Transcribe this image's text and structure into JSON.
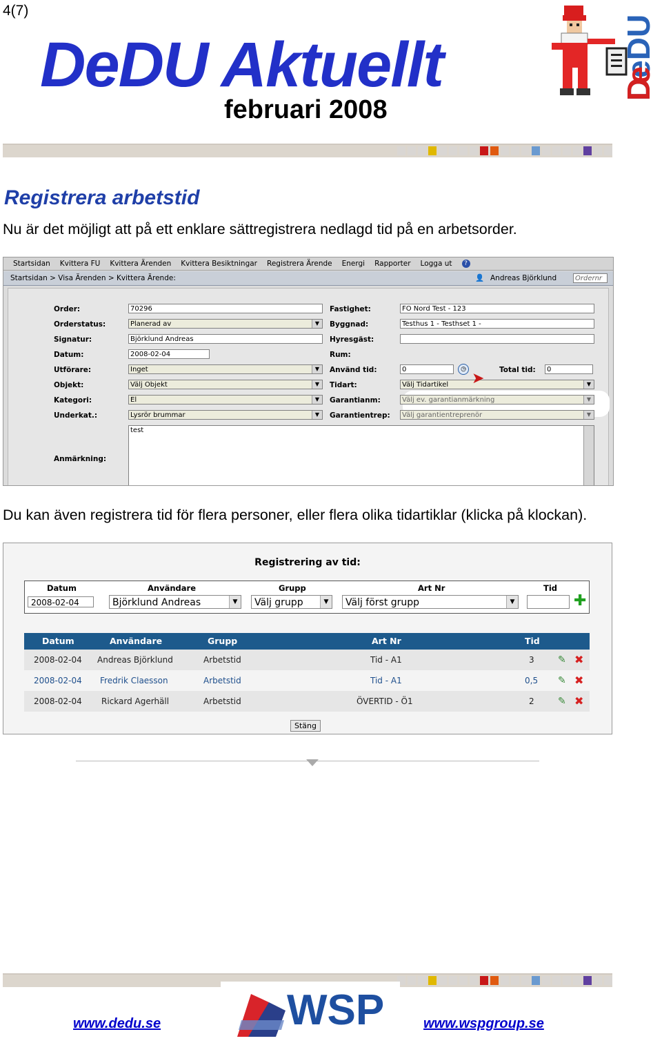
{
  "header": {
    "page_number": "4(7)",
    "masthead_part1": "DeDU",
    "masthead_part2": "Aktuellt",
    "issue": "februari 2008",
    "logo_text": "DeDU"
  },
  "section": {
    "heading": "Registrera arbetstid",
    "intro": "Nu är det möjligt att på ett enklare sättregistrera nedlagd tid på en arbetsorder.",
    "para2": "Du kan även registrera tid för flera personer, eller flera olika tidartiklar (klicka på klockan)."
  },
  "shot1": {
    "menu": [
      "Startsidan",
      "Kvittera FU",
      "Kvittera Ärenden",
      "Kvittera Besiktningar",
      "Registrera Ärende",
      "Energi",
      "Rapporter",
      "Logga ut"
    ],
    "breadcrumb": "Startsidan > Visa Ärenden > Kvittera Ärende:",
    "user": "Andreas Björklund",
    "ordernr_placeholder": "Ordernr",
    "left": {
      "order_label": "Order:",
      "order_value": "70296",
      "status_label": "Orderstatus:",
      "status_value": "Planerad av",
      "signatur_label": "Signatur:",
      "signatur_value": "Björklund Andreas",
      "datum_label": "Datum:",
      "datum_value": "2008-02-04",
      "utforare_label": "Utförare:",
      "utforare_value": "Inget",
      "objekt_label": "Objekt:",
      "objekt_value": "Välj Objekt",
      "kategori_label": "Kategori:",
      "kategori_value": "El",
      "underkat_label": "Underkat.:",
      "underkat_value": "Lysrör brummar",
      "anmarkning_label": "Anmärkning:",
      "anmarkning_value": "test"
    },
    "right": {
      "fastighet_label": "Fastighet:",
      "fastighet_value": "FO Nord Test - 123",
      "byggnad_label": "Byggnad:",
      "byggnad_value": "Testhus 1 - Testhset 1  -",
      "hyresgast_label": "Hyresgäst:",
      "rum_label": "Rum:",
      "anvand_label": "Använd tid:",
      "anvand_value": "0",
      "total_label": "Total tid:",
      "total_value": "0",
      "tidart_label": "Tidart:",
      "tidart_value": "Välj Tidartikel",
      "garantianm_label": "Garantianm:",
      "garantianm_value": "Välj ev. garantianmärkning",
      "garantientrep_label": "Garantientrep:",
      "garantientrep_value": "Välj garantientreprenör"
    }
  },
  "shot2": {
    "title": "Registrering av tid:",
    "headers": {
      "datum": "Datum",
      "anvandare": "Användare",
      "grupp": "Grupp",
      "artnr": "Art Nr",
      "tid": "Tid"
    },
    "inputs": {
      "datum": "2008-02-04",
      "anvandare": "Björklund Andreas",
      "grupp": "Välj grupp",
      "artnr": "Välj först grupp"
    },
    "table_headers": {
      "datum": "Datum",
      "anvandare": "Användare",
      "grupp": "Grupp",
      "artnr": "Art Nr",
      "tid": "Tid"
    },
    "rows": [
      {
        "datum": "2008-02-04",
        "anvandare": "Andreas Björklund",
        "grupp": "Arbetstid",
        "artnr": "Tid - A1",
        "tid": "3"
      },
      {
        "datum": "2008-02-04",
        "anvandare": "Fredrik Claesson",
        "grupp": "Arbetstid",
        "artnr": "Tid - A1",
        "tid": "0,5"
      },
      {
        "datum": "2008-02-04",
        "anvandare": "Rickard Agerhäll",
        "grupp": "Arbetstid",
        "artnr": "ÖVERTID - Ö1",
        "tid": "2"
      }
    ],
    "close": "Stäng"
  },
  "footer": {
    "link_left": "www.dedu.se",
    "link_right": "www.wspgroup.se",
    "logo_text": "WSP"
  },
  "colors": {
    "masthead_blue": "#2230c8",
    "heading_blue": "#1f3fa8",
    "table_header": "#1d5a8c"
  }
}
